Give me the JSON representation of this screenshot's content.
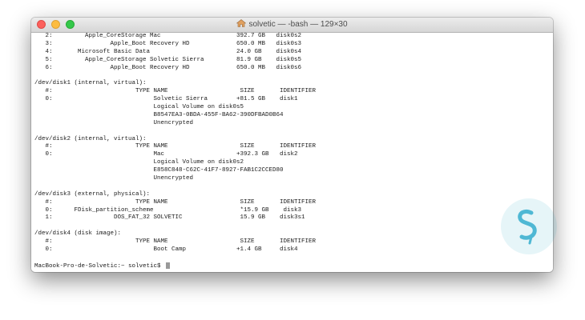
{
  "window": {
    "title": "solvetic — -bash — 129×30",
    "controls": [
      "close",
      "minimize",
      "maximize"
    ]
  },
  "terminal": {
    "lines": [
      "   2:         Apple_CoreStorage Mac                     392.7 GB   disk0s2",
      "   3:                Apple_Boot Recovery HD             650.0 MB   disk0s3",
      "   4:       Microsoft Basic Data                        24.0 GB    disk0s4",
      "   5:         Apple_CoreStorage Solvetic Sierra         81.9 GB    disk0s5",
      "   6:                Apple_Boot Recovery HD             650.0 MB   disk0s6",
      "",
      "/dev/disk1 (internal, virtual):",
      "   #:                       TYPE NAME                    SIZE       IDENTIFIER",
      "   0:                            Solvetic Sierra        +81.5 GB    disk1",
      "                                 Logical Volume on disk0s5",
      "                                 B8547EA3-0BDA-455F-BA62-390DFBAD0B64",
      "                                 Unencrypted",
      "",
      "/dev/disk2 (internal, virtual):",
      "   #:                       TYPE NAME                    SIZE       IDENTIFIER",
      "   0:                            Mac                    +392.3 GB   disk2",
      "                                 Logical Volume on disk0s2",
      "                                 E858C848-C62C-41F7-8927-FAB1C2CCED80",
      "                                 Unencrypted",
      "",
      "/dev/disk3 (external, physical):",
      "   #:                       TYPE NAME                    SIZE       IDENTIFIER",
      "   0:      FDisk_partition_scheme                        *15.9 GB    disk3",
      "   1:                 DOS_FAT_32 SOLVETIC                15.9 GB    disk3s1",
      "",
      "/dev/disk4 (disk image):",
      "   #:                       TYPE NAME                    SIZE       IDENTIFIER",
      "   0:                            Boot Camp              +1.4 GB     disk4",
      "",
      "MacBook-Pro-de-Solvetic:~ solvetic$ "
    ]
  },
  "colors": {
    "text": "#1a1a1a",
    "background": "#ffffff",
    "close": "#fc605c",
    "minimize": "#fdbc40",
    "maximize": "#34c84a"
  }
}
